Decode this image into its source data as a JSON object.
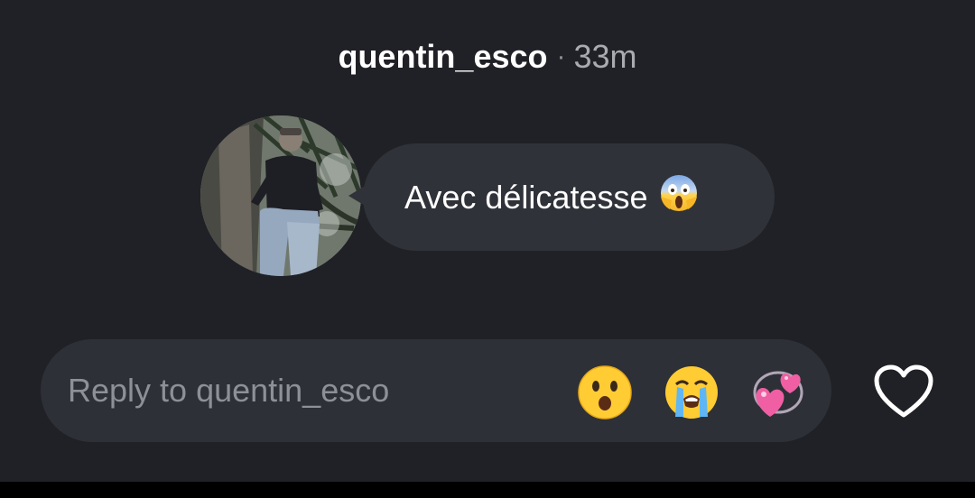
{
  "header": {
    "username": "quentin_esco",
    "separator": "·",
    "time": "33m"
  },
  "story_reply": {
    "avatar_icon": "profile-photo",
    "message": "Avec délicatesse",
    "message_emoji": "face-screaming-in-fear"
  },
  "composer": {
    "placeholder": "Reply to quentin_esco",
    "value": ""
  },
  "quick_reactions": [
    {
      "name": "face-with-open-mouth",
      "emoji": "😮"
    },
    {
      "name": "loudly-crying-face",
      "emoji": "😭"
    },
    {
      "name": "two-hearts",
      "emoji": "💞"
    }
  ],
  "like_icon": "heart-outline-icon",
  "colors": {
    "background": "#202126",
    "bubble": "#303239",
    "composer": "#2e3037",
    "text": "#ffffff",
    "muted_text": "#8e9097"
  }
}
